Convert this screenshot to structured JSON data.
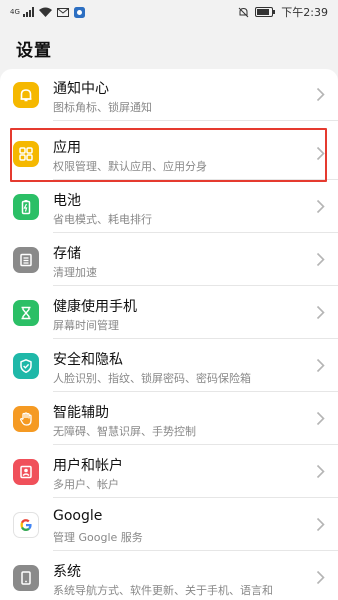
{
  "status_bar": {
    "signal_label": "4G",
    "time": "下午2:39"
  },
  "page_title": "设置",
  "items": [
    {
      "title": "通知中心",
      "subtitle": "图标角标、锁屏通知",
      "icon": "bell-icon",
      "color": "#f5b800"
    },
    {
      "title": "应用",
      "subtitle": "权限管理、默认应用、应用分身",
      "icon": "apps-grid-icon",
      "color": "#f5b800"
    },
    {
      "title": "电池",
      "subtitle": "省电模式、耗电排行",
      "icon": "battery-icon",
      "color": "#2bbf66"
    },
    {
      "title": "存储",
      "subtitle": "清理加速",
      "icon": "storage-icon",
      "color": "#8a8a8a"
    },
    {
      "title": "健康使用手机",
      "subtitle": "屏幕时间管理",
      "icon": "hourglass-icon",
      "color": "#2bbf66"
    },
    {
      "title": "安全和隐私",
      "subtitle": "人脸识别、指纹、锁屏密码、密码保险箱",
      "icon": "shield-icon",
      "color": "#1fb8a8"
    },
    {
      "title": "智能辅助",
      "subtitle": "无障碍、智慧识屏、手势控制",
      "icon": "hand-icon",
      "color": "#f59a23"
    },
    {
      "title": "用户和帐户",
      "subtitle": "多用户、帐户",
      "icon": "user-icon",
      "color": "#f0505a"
    },
    {
      "title": "Google",
      "subtitle": "管理 Google 服务",
      "icon": "google-icon",
      "color": "#ffffff"
    },
    {
      "title": "系统",
      "subtitle": "系统导航方式、软件更新、关于手机、语言和",
      "icon": "system-icon",
      "color": "#8a8a8a"
    }
  ]
}
